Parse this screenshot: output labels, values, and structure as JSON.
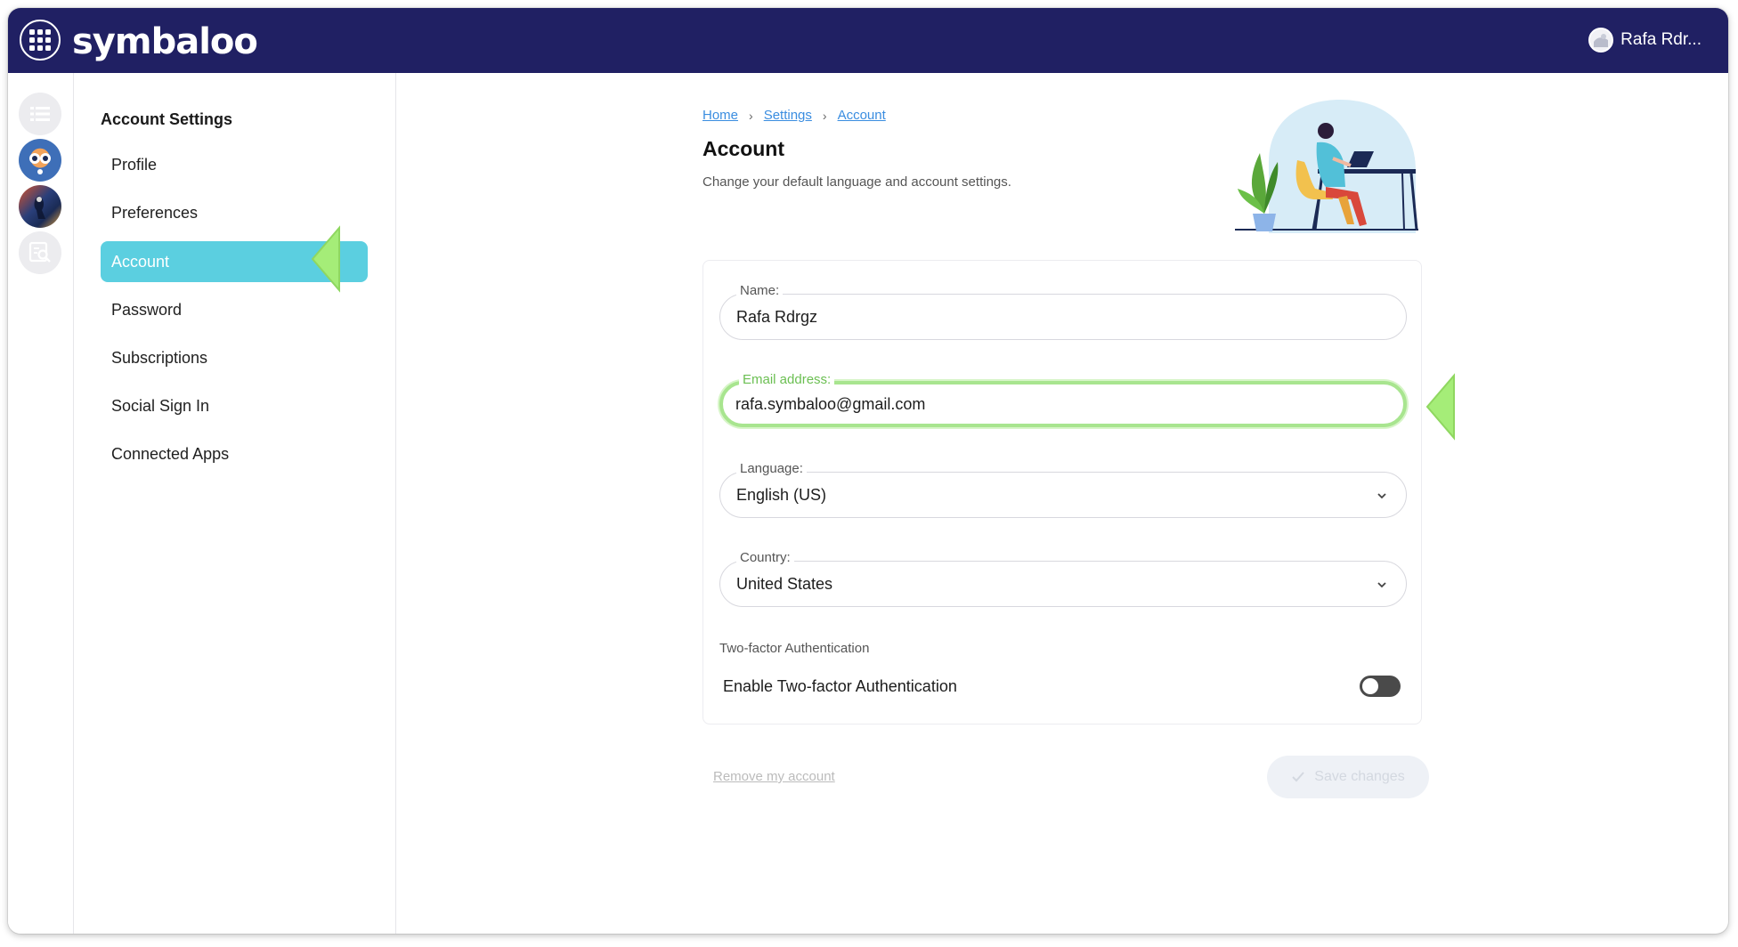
{
  "app": {
    "brand": "symbaloo",
    "user_name": "Rafa Rdr..."
  },
  "sidebar": {
    "heading": "Account Settings",
    "items": [
      {
        "label": "Profile"
      },
      {
        "label": "Preferences"
      },
      {
        "label": "Account",
        "active": true
      },
      {
        "label": "Password"
      },
      {
        "label": "Subscriptions"
      },
      {
        "label": "Social Sign In"
      },
      {
        "label": "Connected Apps"
      }
    ]
  },
  "breadcrumb": [
    "Home",
    "Settings",
    "Account"
  ],
  "page": {
    "title": "Account",
    "subtitle": "Change your default language and account settings."
  },
  "form": {
    "name": {
      "label": "Name:",
      "value": "Rafa Rdrgz"
    },
    "email": {
      "label": "Email address:",
      "value": "rafa.symbaloo@gmail.com"
    },
    "language": {
      "label": "Language:",
      "value": "English (US)"
    },
    "country": {
      "label": "Country:",
      "value": "United States"
    },
    "two_factor": {
      "heading": "Two-factor Authentication",
      "label": "Enable Two-factor Authentication",
      "enabled": false
    }
  },
  "actions": {
    "remove_account": "Remove my account",
    "save": "Save changes"
  },
  "colors": {
    "topbar": "#202063",
    "active_nav": "#5bcfe0",
    "focus_green": "#a8e58f",
    "link": "#3a8de0"
  }
}
